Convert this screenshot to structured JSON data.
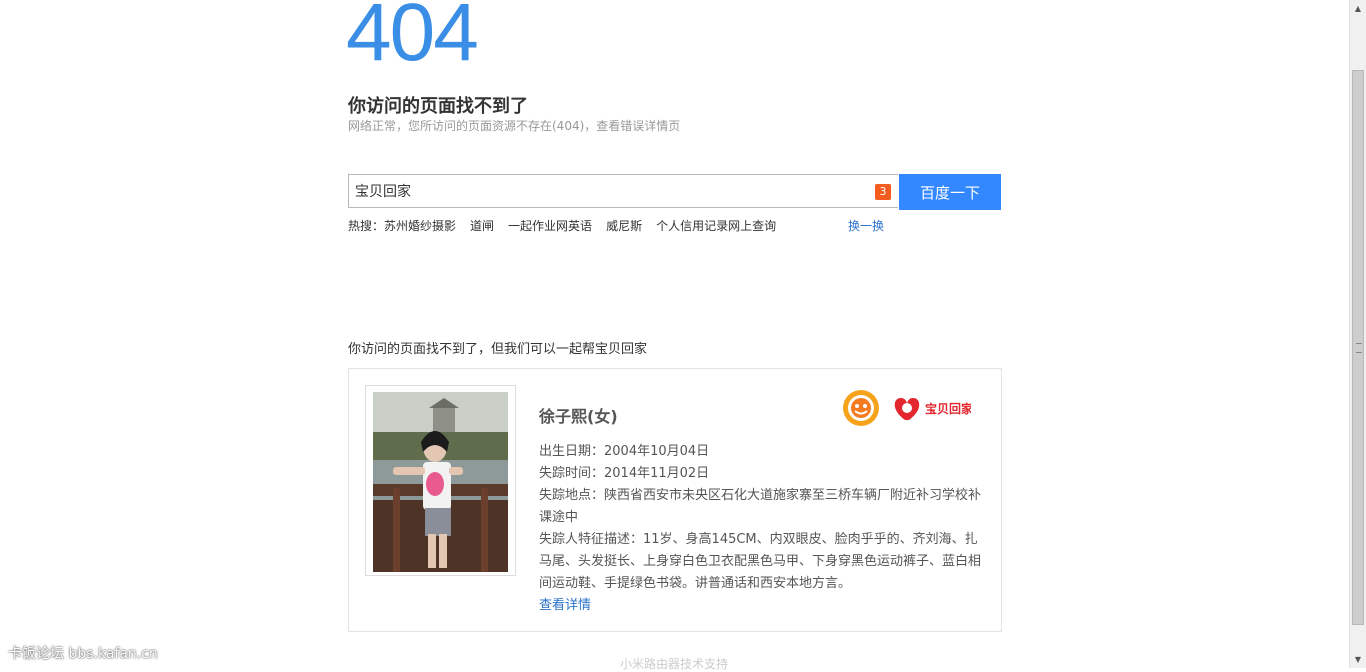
{
  "error": {
    "code": "404",
    "title": "你访问的页面找不到了",
    "subtitle": "网络正常，您所访问的页面资源不存在(404)，查看错误详情页"
  },
  "search": {
    "value": "宝贝回家",
    "badge": "3",
    "button_label": "百度一下",
    "hot_label": "热搜：",
    "hot_items": [
      "苏州婚纱摄影",
      "道闸",
      "一起作业网英语",
      "威尼斯",
      "个人信用记录网上查询"
    ],
    "refresh_label": "换一换"
  },
  "missing": {
    "section_title": "你访问的页面找不到了，但我们可以一起帮宝贝回家",
    "name": "徐子熙(女)",
    "birth": "出生日期：2004年10月04日",
    "missing_time": "失踪时间：2014年11月02日",
    "location": "失踪地点：陕西省西安市未央区石化大道施家寨至三桥车辆厂附近补习学校补课途中",
    "features": "失踪人特征描述：11岁、身高145CM、内双眼皮、脸肉乎乎的、齐刘海、扎马尾、头发挺长、上身穿白色卫衣配黑色马甲、下身穿黑色运动裤子、蓝白相间运动鞋、手提绿色书袋。讲普通话和西安本地方言。",
    "detail_link": "查看详情",
    "logo2_text": "宝贝回家"
  },
  "footer": {
    "watermark": "卡饭论坛 bbs.kafan.cn",
    "faint": "小米路由器技术支持"
  },
  "colors": {
    "accent": "#3388ff",
    "code": "#3a8ee6",
    "link": "#2a73c9",
    "badge": "#f45b1e"
  }
}
